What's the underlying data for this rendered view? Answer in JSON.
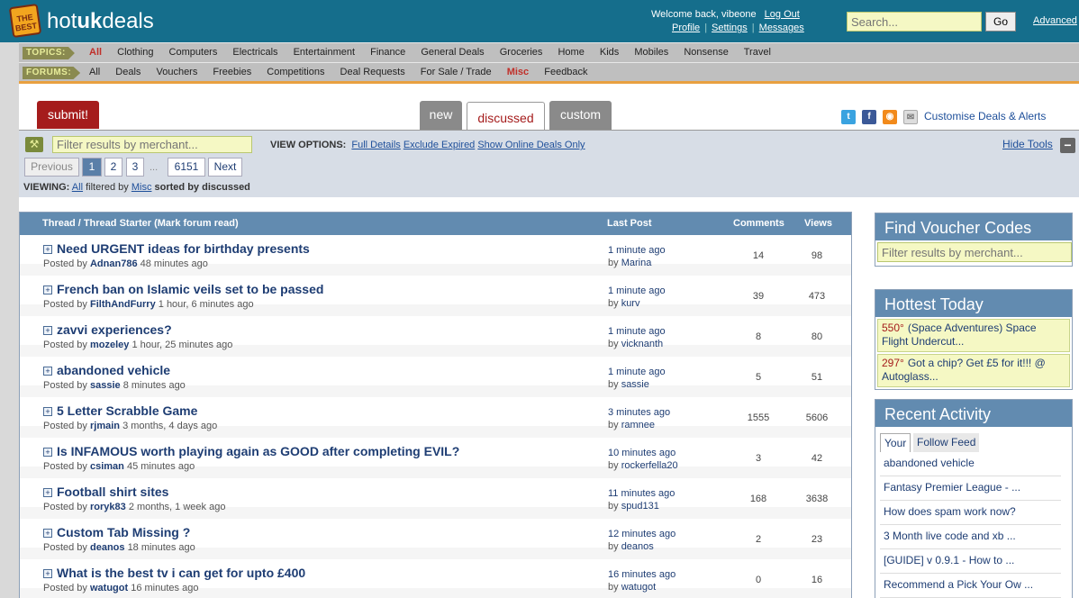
{
  "header": {
    "logo_badge": "THE BEST",
    "logo_prefix": "hot",
    "logo_bold": "uk",
    "logo_suffix": "deals",
    "welcome": "Welcome back, vibeone",
    "logout": "Log Out",
    "profile": "Profile",
    "settings": "Settings",
    "messages": "Messages",
    "search_placeholder": "Search...",
    "go": "Go",
    "advanced": "Advanced"
  },
  "topics": {
    "tag": "TOPICS:",
    "items": [
      "All",
      "Clothing",
      "Computers",
      "Electricals",
      "Entertainment",
      "Finance",
      "General Deals",
      "Groceries",
      "Home",
      "Kids",
      "Mobiles",
      "Nonsense",
      "Travel"
    ]
  },
  "forums": {
    "tag": "FORUMS:",
    "items": [
      "All",
      "Deals",
      "Vouchers",
      "Freebies",
      "Competitions",
      "Deal Requests",
      "For Sale / Trade",
      "Misc",
      "Feedback"
    ]
  },
  "tabs": {
    "submit": "submit!",
    "new": "new",
    "discussed": "discussed",
    "custom": "custom",
    "customise": "Customise Deals & Alerts"
  },
  "toolbar": {
    "filter_placeholder": "Filter results by merchant...",
    "view_options_label": "VIEW OPTIONS:",
    "full_details": "Full Details",
    "exclude_expired": "Exclude Expired",
    "show_online": "Show Online Deals Only",
    "hide_tools": "Hide Tools"
  },
  "pagination": {
    "previous": "Previous",
    "p1": "1",
    "p2": "2",
    "p3": "3",
    "ellipsis": "...",
    "last": "6151",
    "next": "Next"
  },
  "viewing": {
    "label": "VIEWING:",
    "all": "All",
    "filtered_by": "filtered by",
    "forum": "Misc",
    "sorted": "sorted by discussed"
  },
  "table": {
    "col_thread": "Thread / Thread Starter (Mark forum read)",
    "col_last": "Last Post",
    "col_comments": "Comments",
    "col_views": "Views",
    "posted_by": "Posted by",
    "by": "by",
    "rows": [
      {
        "title": "Need URGENT ideas for birthday presents",
        "user": "Adnan786",
        "age": "48 minutes ago",
        "last_time": "1 minute ago",
        "last_by": "Marina",
        "comments": "14",
        "views": "98"
      },
      {
        "title": "French ban on Islamic veils set to be passed",
        "user": "FilthAndFurry",
        "age": "1 hour, 6 minutes ago",
        "last_time": "1 minute ago",
        "last_by": "kurv",
        "comments": "39",
        "views": "473"
      },
      {
        "title": "zavvi experiences?",
        "user": "mozeley",
        "age": "1 hour, 25 minutes ago",
        "last_time": "1 minute ago",
        "last_by": "vicknanth",
        "comments": "8",
        "views": "80"
      },
      {
        "title": "abandoned vehicle",
        "user": "sassie",
        "age": "8 minutes ago",
        "last_time": "1 minute ago",
        "last_by": "sassie",
        "comments": "5",
        "views": "51"
      },
      {
        "title": "5 Letter Scrabble Game",
        "user": "rjmain",
        "age": "3 months, 4 days ago",
        "last_time": "3 minutes ago",
        "last_by": "ramnee",
        "comments": "1555",
        "views": "5606"
      },
      {
        "title": "Is INFAMOUS worth playing again as GOOD after completing EVIL?",
        "user": "csiman",
        "age": "45 minutes ago",
        "last_time": "10 minutes ago",
        "last_by": "rockerfella20",
        "comments": "3",
        "views": "42"
      },
      {
        "title": "Football shirt sites",
        "user": "roryk83",
        "age": "2 months, 1 week ago",
        "last_time": "11 minutes ago",
        "last_by": "spud131",
        "comments": "168",
        "views": "3638"
      },
      {
        "title": "Custom Tab Missing ?",
        "user": "deanos",
        "age": "18 minutes ago",
        "last_time": "12 minutes ago",
        "last_by": "deanos",
        "comments": "2",
        "views": "23"
      },
      {
        "title": "What is the best tv i can get for upto £400",
        "user": "watugot",
        "age": "16 minutes ago",
        "last_time": "16 minutes ago",
        "last_by": "watugot",
        "comments": "0",
        "views": "16"
      }
    ]
  },
  "sidebar": {
    "voucher_title": "Find Voucher Codes",
    "voucher_placeholder": "Filter results by merchant...",
    "hottest_title": "Hottest Today",
    "hottest": [
      {
        "temp": "550°",
        "text": "(Space Adventures) Space Flight Undercut..."
      },
      {
        "temp": "297°",
        "text": "Got a chip? Get £5 for it!!! @ Autoglass..."
      }
    ],
    "activity_title": "Recent Activity",
    "tab_your": "Your",
    "tab_follow": "Follow Feed",
    "activity": [
      "abandoned vehicle",
      "Fantasy Premier League - ...",
      "How does spam work now?",
      "3 Month live code and xb ...",
      "[GUIDE] v 0.9.1 - How to ...",
      "Recommend a Pick Your Ow ..."
    ]
  }
}
